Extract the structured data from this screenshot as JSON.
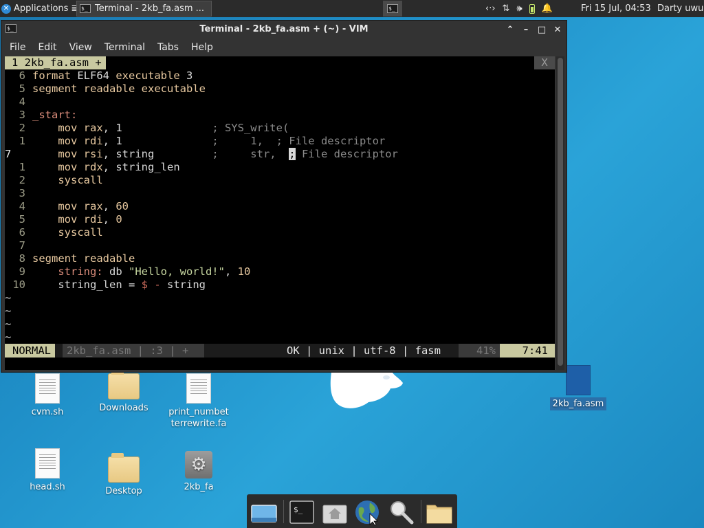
{
  "top_panel": {
    "apps_label": "Applications",
    "apps_suffix": "≣",
    "task_label": "Terminal - 2kb_fa.asm ...",
    "clock": "Fri 15 Jul, 04:53",
    "user": "Darty uwu"
  },
  "window": {
    "title": "Terminal - 2kb_fa.asm + (~) - VIM",
    "menu": [
      "File",
      "Edit",
      "View",
      "Terminal",
      "Tabs",
      "Help"
    ]
  },
  "vim": {
    "tab_label": "1 2kb_fa.asm +",
    "tab_close": "X",
    "lines": [
      {
        "n": "6",
        "code": "format ELF64 executable 3"
      },
      {
        "n": "5",
        "code": "segment readable executable"
      },
      {
        "n": "4",
        "code": ""
      },
      {
        "n": "3",
        "code": "_start:"
      },
      {
        "n": "2",
        "code": "    mov rax, 1              ; SYS_write("
      },
      {
        "n": "1",
        "code": "    mov rdi, 1              ;     1,  ; File descriptor"
      },
      {
        "n": "7",
        "code": "    mov rsi, string         ;     str,  ; File descriptor",
        "current": true
      },
      {
        "n": "1",
        "code": "    mov rdx, string_len"
      },
      {
        "n": "2",
        "code": "    syscall"
      },
      {
        "n": "3",
        "code": ""
      },
      {
        "n": "4",
        "code": "    mov rax, 60"
      },
      {
        "n": "5",
        "code": "    mov rdi, 0"
      },
      {
        "n": "6",
        "code": "    syscall"
      },
      {
        "n": "7",
        "code": ""
      },
      {
        "n": "8",
        "code": "segment readable"
      },
      {
        "n": "9",
        "code": "    string: db \"Hello, world!\", 10"
      },
      {
        "n": "10",
        "code": "    string_len = $ - string"
      }
    ],
    "empty_line_marker": "~",
    "empty_lines": 4,
    "status": {
      "mode": "NORMAL",
      "file": "2kb_fa.asm | :3 | +",
      "info": "OK | unix | utf-8 | fasm",
      "percent": "41%",
      "position": "7:41"
    }
  },
  "desktop": {
    "icons": [
      {
        "label": "cvm.sh"
      },
      {
        "label": "Downloads"
      },
      {
        "label": "print_numbet terrewrite.fa"
      },
      {
        "label": "2kb_fa.asm"
      },
      {
        "label": "head.sh"
      },
      {
        "label": "Desktop"
      },
      {
        "label": "2kb_fa"
      }
    ]
  },
  "colors": {
    "desktop_bg": "#1f8fc8",
    "panel_bg": "#2b2b2b",
    "vim_bg": "#000000",
    "statusline_accent": "#c9c9a0"
  }
}
